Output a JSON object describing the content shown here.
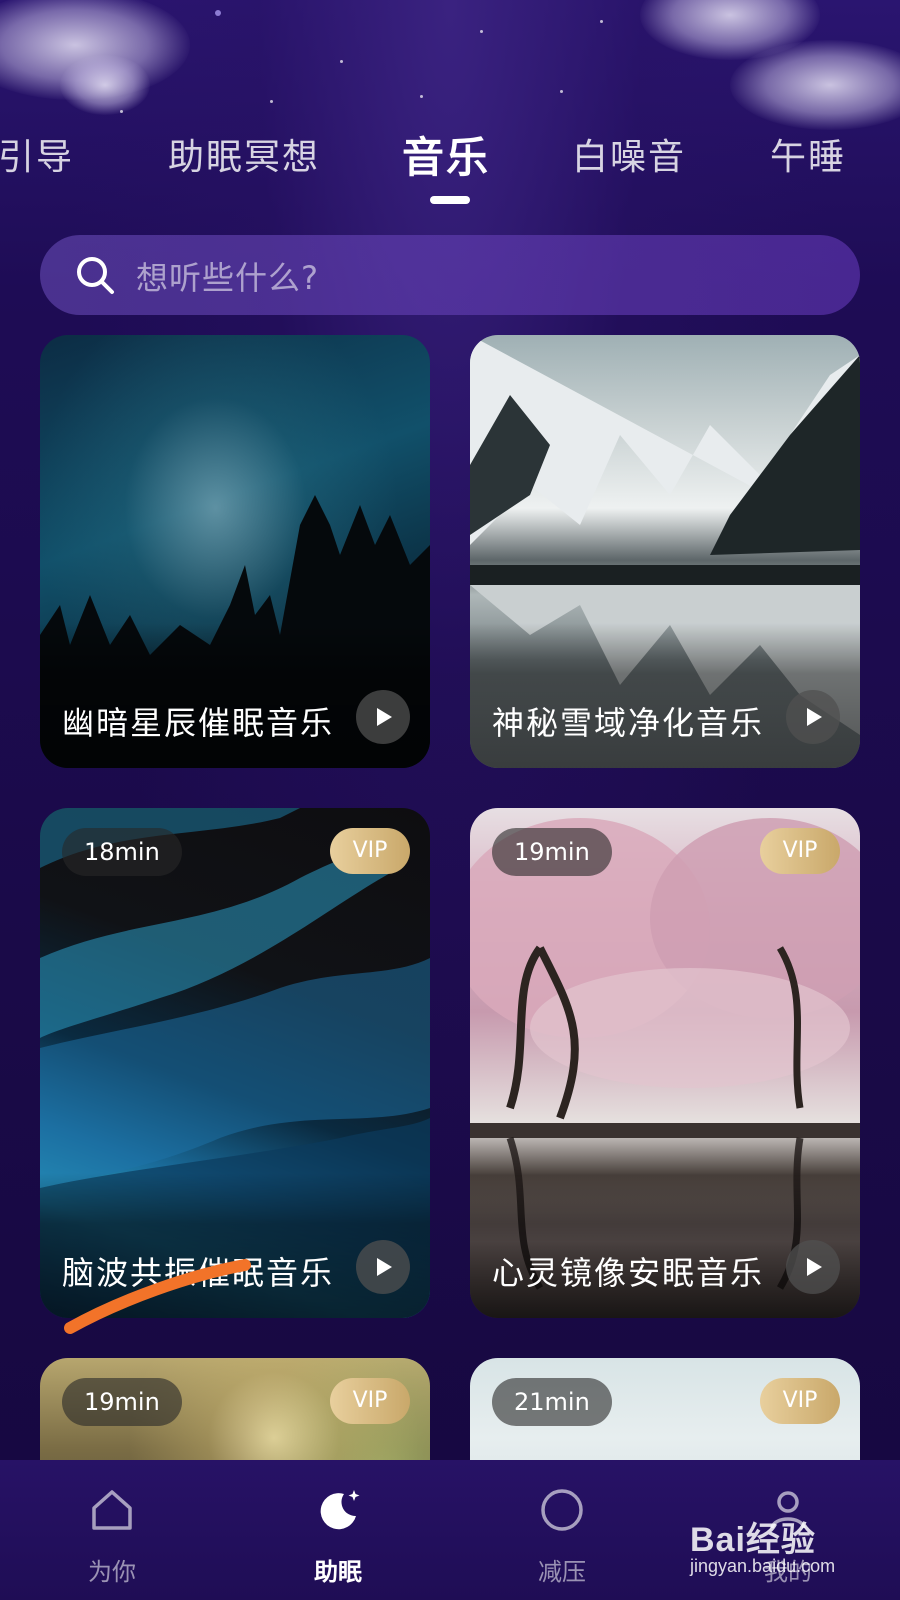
{
  "tabs": [
    {
      "label": "眠引导"
    },
    {
      "label": "助眠冥想"
    },
    {
      "label": "音乐",
      "active": true
    },
    {
      "label": "白噪音"
    },
    {
      "label": "午睡"
    }
  ],
  "search": {
    "placeholder": "想听些什么?"
  },
  "cards": [
    {
      "title": "幽暗星辰催眠音乐",
      "duration": "",
      "vip": false
    },
    {
      "title": "神秘雪域净化音乐",
      "duration": "",
      "vip": false
    },
    {
      "title": "脑波共振催眠音乐",
      "duration": "18min",
      "vip": true,
      "vip_label": "VIP"
    },
    {
      "title": "心灵镜像安眠音乐",
      "duration": "19min",
      "vip": true,
      "vip_label": "VIP"
    },
    {
      "title": "",
      "duration": "19min",
      "vip": true,
      "vip_label": "VIP"
    },
    {
      "title": "",
      "duration": "21min",
      "vip": true,
      "vip_label": "VIP"
    }
  ],
  "nav": [
    {
      "label": "为你",
      "icon": "home-icon"
    },
    {
      "label": "助眠",
      "icon": "moon-icon",
      "active": true
    },
    {
      "label": "减压",
      "icon": "circle-icon"
    },
    {
      "label": "我的",
      "icon": "profile-icon"
    }
  ],
  "watermark": {
    "logo": "Bai经验",
    "url": "jingyan.baidu.com"
  },
  "colors": {
    "background": "#1d0b4a",
    "accent": "#ffffff",
    "vip_gold": "#d4b67c",
    "nav_bg": "#24105f"
  }
}
